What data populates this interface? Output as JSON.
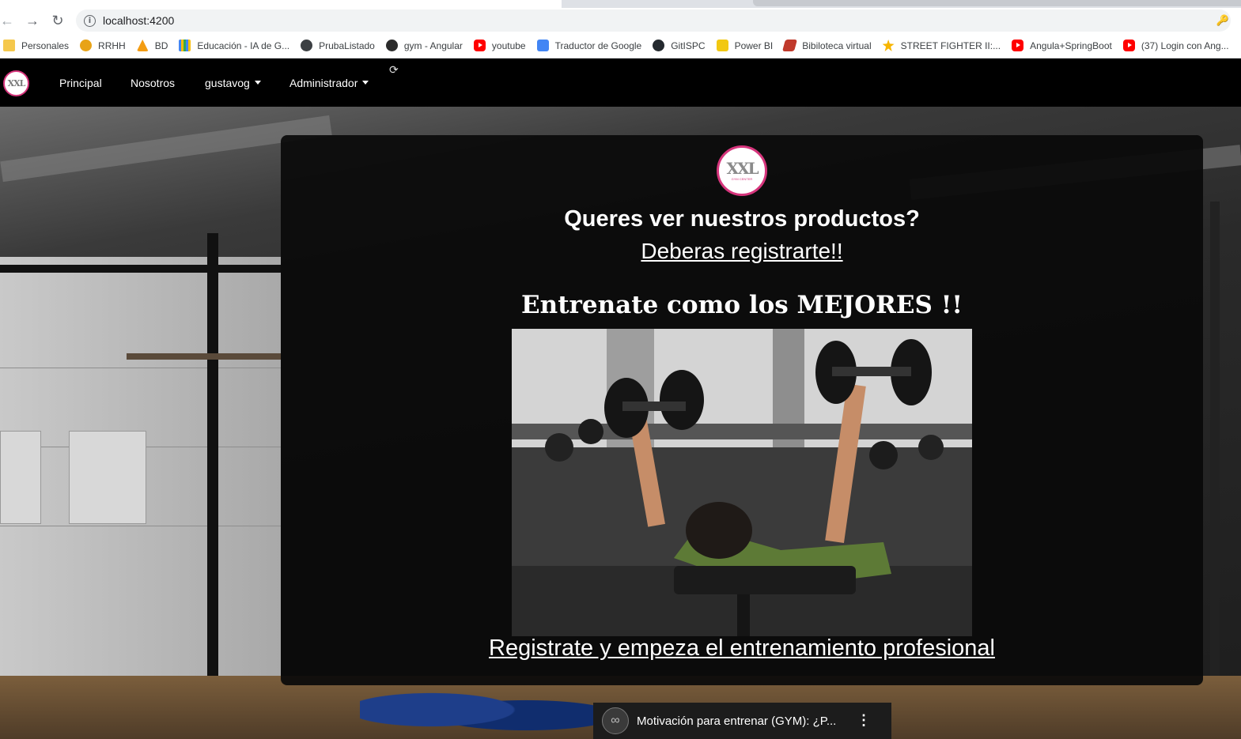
{
  "browser": {
    "url": "localhost:4200",
    "bookmarks": [
      {
        "label": "Personales",
        "icon": "folder-icon"
      },
      {
        "label": "RRHH",
        "icon": "rrhh-icon"
      },
      {
        "label": "BD",
        "icon": "bd-icon"
      },
      {
        "label": "Educación - IA de G...",
        "icon": "education-icon"
      },
      {
        "label": "PrubaListado",
        "icon": "globe-icon"
      },
      {
        "label": "gym - Angular",
        "icon": "angular-icon"
      },
      {
        "label": "youtube",
        "icon": "youtube-icon"
      },
      {
        "label": "Traductor de Google",
        "icon": "translate-icon"
      },
      {
        "label": "GitISPC",
        "icon": "github-icon"
      },
      {
        "label": "Power BI",
        "icon": "powerbi-icon"
      },
      {
        "label": "Bibiloteca virtual",
        "icon": "library-icon"
      },
      {
        "label": "STREET FIGHTER II:...",
        "icon": "star-icon"
      },
      {
        "label": "Angula+SpringBoot",
        "icon": "youtube-icon"
      },
      {
        "label": "(37) Login con Ang...",
        "icon": "youtube-icon"
      }
    ]
  },
  "navbar": {
    "brand_text": "XXL",
    "links": {
      "principal": "Principal",
      "nosotros": "Nosotros",
      "user": "gustavog",
      "admin": "Administrador"
    }
  },
  "card": {
    "logo_text": "XXL",
    "logo_subtext": "GYM CENTER",
    "question": "Queres ver nuestros productos?",
    "register_link": "Deberas registrarte!!",
    "headline": "Entrenate como los MEJORES !!",
    "cta_link": "Registrate y empeza el entrenamiento profesional"
  },
  "video": {
    "title": "Motivación para entrenar (GYM): ¿P..."
  },
  "colors": {
    "brand_pink": "#d6357c",
    "navbar_bg": "#000000",
    "card_bg": "#0a0a0a"
  }
}
